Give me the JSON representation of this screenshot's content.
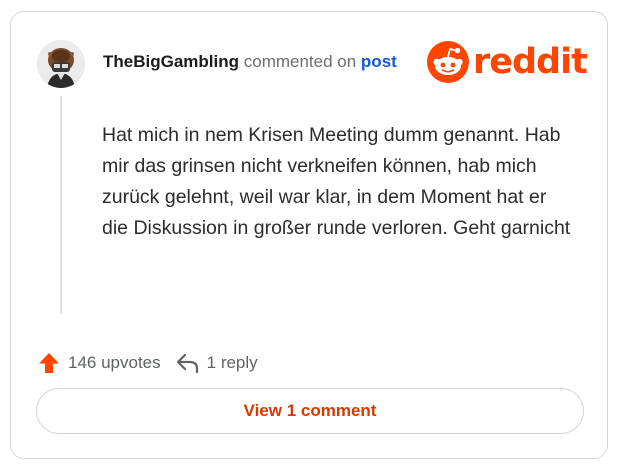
{
  "comment": {
    "username": "TheBigGambling",
    "commented_on": "commented on",
    "post_link": "post",
    "body": "Hat mich in nem Krisen Meeting dumm genannt. Hab mir das grinsen nicht verkneifen können, hab mich zurück gelehnt, weil war klar, in dem Moment hat er die Diskussion in großer runde verloren. Geht garnicht",
    "upvotes": "146 upvotes",
    "replies": "1 reply",
    "view_button": "View 1 comment"
  },
  "logo": {
    "wordmark": "reddit"
  },
  "icons": {
    "avatar": "avatar-image",
    "logo": "reddit-alien-icon",
    "upvote": "upvote-arrow-icon",
    "reply": "reply-arrow-icon"
  },
  "colors": {
    "brand": "#ff4500",
    "link": "#1558d6",
    "button_text": "#d93900",
    "text": "#2a2c2e",
    "muted": "#6b6e70",
    "border": "#d4d7da"
  }
}
